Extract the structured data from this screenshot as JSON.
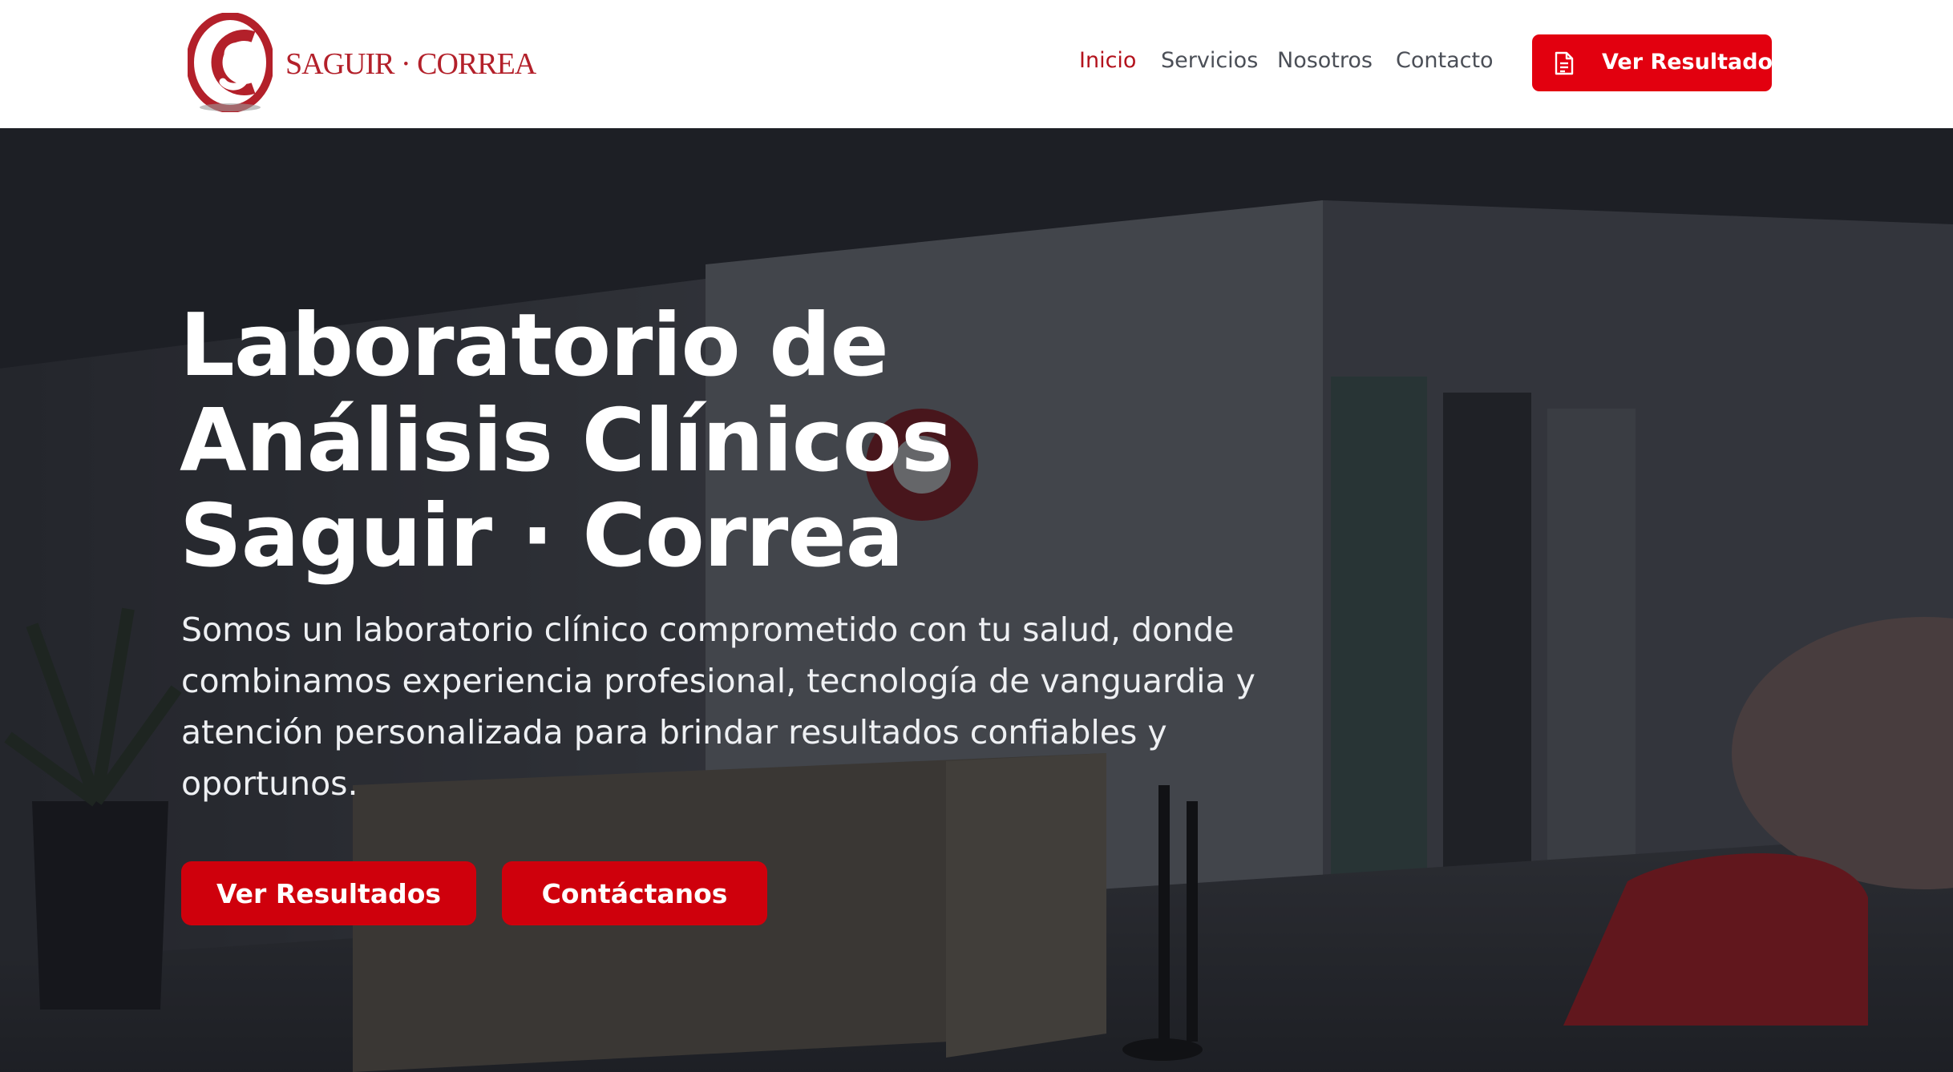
{
  "brand": {
    "name": "SAGUIR · CORREA",
    "logo_icon": "cs-monogram-logo",
    "brand_color": "#b3202a"
  },
  "nav": {
    "items": [
      {
        "label": "Inicio",
        "active": true
      },
      {
        "label": "Servicios",
        "active": false
      },
      {
        "label": "Nosotros",
        "active": false
      },
      {
        "label": "Contacto",
        "active": false
      }
    ],
    "cta": {
      "label": "Ver Resultados",
      "icon": "document-icon"
    },
    "active_color": "#b3121c",
    "cta_color": "#e2000f"
  },
  "hero": {
    "title_lines": [
      "Laboratorio de",
      "Análisis Clínicos",
      "Saguir · Correa"
    ],
    "subtitle": "Somos un laboratorio clínico comprometido con tu salud, donde combinamos experiencia profesional, tecnología de vanguardia y atención personalizada para brindar resultados confiables y oportunos.",
    "buttons": [
      {
        "label": "Ver Resultados"
      },
      {
        "label": "Contáctanos"
      }
    ],
    "button_color": "#cf000c"
  }
}
